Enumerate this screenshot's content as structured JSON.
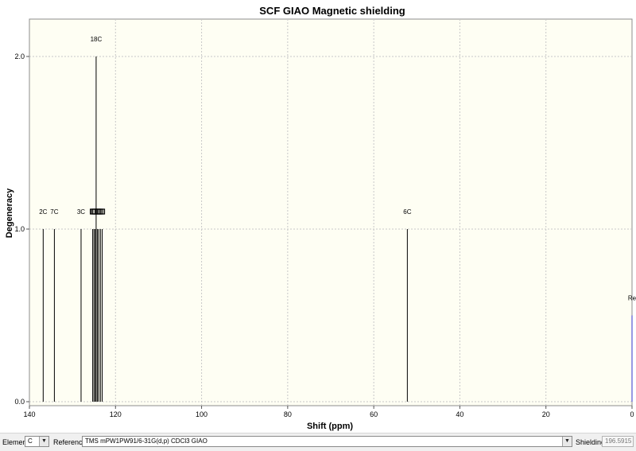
{
  "chart_data": {
    "type": "bar",
    "title": "SCF GIAO Magnetic shielding",
    "xlabel": "Shift (ppm)",
    "ylabel": "Degeneracy",
    "xlim": [
      140,
      0
    ],
    "ylim": [
      0,
      2.2
    ],
    "xticks": [
      140,
      120,
      100,
      80,
      60,
      40,
      20,
      0
    ],
    "yticks": [
      "0.0",
      "1.0",
      "2.0"
    ],
    "grid": true,
    "background": "#fefef3",
    "series": [
      {
        "points": [
          {
            "x": 136.8,
            "y": 1,
            "label": "2C"
          },
          {
            "x": 134.2,
            "y": 1,
            "label": "7C"
          },
          {
            "x": 128.0,
            "y": 1,
            "label": "3C"
          },
          {
            "x": 125.3,
            "y": 1,
            "label": ""
          },
          {
            "x": 125.0,
            "y": 1,
            "label": ""
          },
          {
            "x": 124.7,
            "y": 1,
            "label": ""
          },
          {
            "x": 124.5,
            "y": 2,
            "label": "18C"
          },
          {
            "x": 124.2,
            "y": 1,
            "label": ""
          },
          {
            "x": 123.9,
            "y": 1,
            "label": ""
          },
          {
            "x": 123.5,
            "y": 1,
            "label": ""
          },
          {
            "x": 123.1,
            "y": 1,
            "label": ""
          },
          {
            "x": 52.2,
            "y": 1,
            "label": "6C"
          },
          {
            "x": 0.0,
            "y": 0.5,
            "label": "Re",
            "color": "#3333cc"
          }
        ]
      }
    ]
  },
  "toolbar": {
    "element_label": "Element:",
    "element_value": "C",
    "reference_label": "Reference:",
    "reference_value": "TMS mPW1PW91/6-31G(d,p) CDCl3 GIAO",
    "shielding_label": "Shielding:",
    "shielding_value": "196.5915",
    "dropdown_arrow": "▼"
  }
}
